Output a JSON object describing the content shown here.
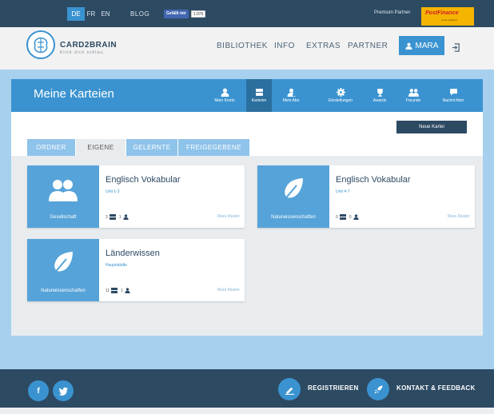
{
  "topbar": {
    "languages": [
      "DE",
      "FR",
      "EN"
    ],
    "blog": "BLOG",
    "fb_like": "Gefällt mir",
    "fb_count": "1.076",
    "premium": "Premium Partner",
    "partner_logo": "PostFinance",
    "partner_sub": "Unser Angebot"
  },
  "header": {
    "logo_name": "CARD2BRAIN",
    "logo_tagline": "Klick dich schlau.",
    "nav": [
      "BIBLIOTHEK",
      "INFO",
      "EXTRAS",
      "PARTNER"
    ],
    "user": "MARA"
  },
  "main": {
    "title": "Meine Karteien",
    "icon_nav": [
      {
        "label": "Mein Konto",
        "icon": "user-icon"
      },
      {
        "label": "Karteien",
        "icon": "card-box-icon"
      },
      {
        "label": "Mein Abo",
        "icon": "subscription-icon"
      },
      {
        "label": "Einstellungen",
        "icon": "gear-icon"
      },
      {
        "label": "Awards",
        "icon": "trophy-icon"
      },
      {
        "label": "Freunde",
        "icon": "friends-icon"
      },
      {
        "label": "Nachrichten",
        "icon": "speech-bubble-icon"
      }
    ],
    "new_button": "Neue Kartei",
    "subtabs": [
      "ORDNER",
      "EIGENE",
      "GELERNTE",
      "FREIGEGEBENE"
    ],
    "active_subtab": "EIGENE",
    "cards": [
      {
        "category": "Gesellschaft",
        "title": "Englisch Vokabular",
        "subtitle": "Unit 1-3",
        "cards_count": "3",
        "users_count": "1",
        "author": "Mara Muster"
      },
      {
        "category": "Naturwissenschaften",
        "title": "Englisch Vokabular",
        "subtitle": "Unit 4-7",
        "cards_count": "0",
        "users_count": "0",
        "author": "Mara Muster"
      },
      {
        "category": "Naturwissenschaften",
        "title": "Länderwissen",
        "subtitle": "Hauptstädte",
        "cards_count": "11",
        "users_count": "1",
        "author": "Mara Muster"
      }
    ]
  },
  "footer": {
    "facebook": "f",
    "register": "REGISTRIEREN",
    "contact": "KONTAKT & FEEDBACK"
  },
  "colors": {
    "accent": "#3a93d0",
    "dark": "#2d4a63",
    "panel": "#a6d0ee"
  }
}
